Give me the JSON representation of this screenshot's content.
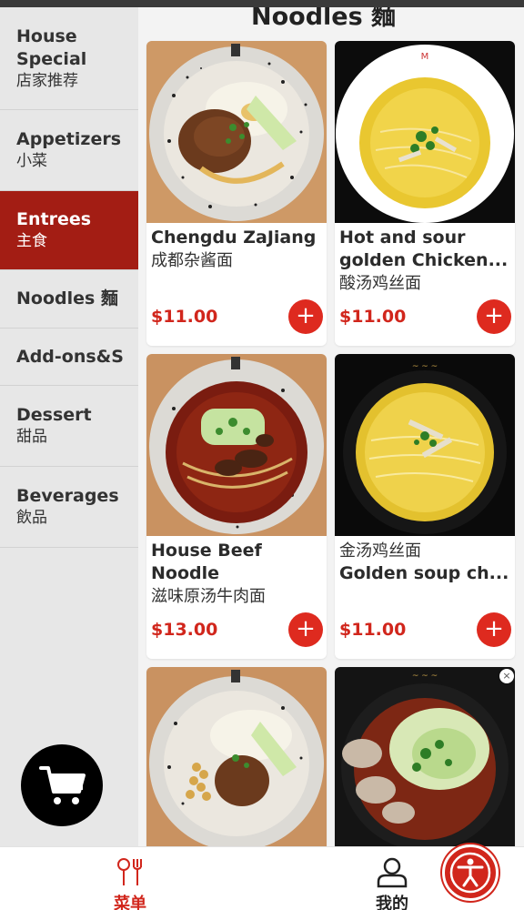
{
  "section_title": "Noodles 麵",
  "sidebar": {
    "items": [
      {
        "en": "House Special",
        "zh": "店家推荐",
        "active": false
      },
      {
        "en": "Appetizers",
        "zh": "小菜",
        "active": false
      },
      {
        "en": "Entrees",
        "zh": "主食",
        "active": true
      },
      {
        "en": "Noodles 麵",
        "zh": "",
        "active": false
      },
      {
        "en": "Add-ons&S",
        "zh": "",
        "active": false
      },
      {
        "en": "Dessert",
        "zh": "甜品",
        "active": false
      },
      {
        "en": "Beverages",
        "zh": "飲品",
        "active": false
      }
    ]
  },
  "items": [
    {
      "line1": "Chengdu ZaJiang",
      "line2": "成都杂酱面",
      "price": "$11.00",
      "add": "+"
    },
    {
      "line1": "Hot and sour",
      "line2": "golden Chicken...",
      "line3": "酸汤鸡丝面",
      "price": "$11.00",
      "add": "+"
    },
    {
      "line1": "House Beef",
      "line2": "Noodle",
      "line3": "滋味原汤牛肉面",
      "price": "$13.00",
      "add": "+"
    },
    {
      "line1": "金汤鸡丝面",
      "line2": "Golden soup ch...",
      "price": "$11.00",
      "add": "+"
    }
  ],
  "close_label": "×",
  "bottom_nav": {
    "menu_label": "菜单",
    "mine_label": "我的"
  },
  "colors": {
    "accent": "#d1261c",
    "active_category": "#a31d14"
  }
}
